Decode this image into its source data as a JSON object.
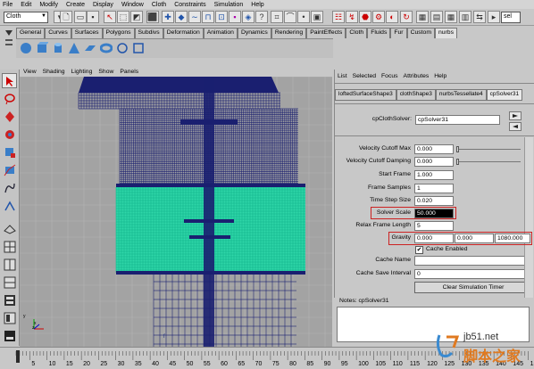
{
  "menubar": [
    "File",
    "Edit",
    "Modify",
    "Create",
    "Display",
    "Window",
    "Cloth",
    "Constraints",
    "Simulation",
    "Help"
  ],
  "status": {
    "mode": "Cloth",
    "field_right": "sel"
  },
  "shelf_tabs": [
    "General",
    "Curves",
    "Surfaces",
    "Polygons",
    "Subdivs",
    "Deformation",
    "Animation",
    "Dynamics",
    "Rendering",
    "PaintEffects",
    "Cloth",
    "Fluids",
    "Fur",
    "Custom",
    "nurbs"
  ],
  "shelf_selected": "nurbs",
  "viewport": {
    "menu": [
      "View",
      "Shading",
      "Lighting",
      "Show",
      "Panels"
    ],
    "frame_label": "f",
    "axis": {
      "x": "x",
      "y": "y",
      "z": "z"
    }
  },
  "attribute_editor": {
    "menu": [
      "List",
      "Selected",
      "Focus",
      "Attributes",
      "Help"
    ],
    "tabs": [
      "loftedSurfaceShape3",
      "clothShape3",
      "nurbsTessellate4",
      "cpSolver31"
    ],
    "selected_tab": "cpSolver31",
    "node_label": "cpClothSolver:",
    "node_name": "cpSolver31",
    "attributes": [
      {
        "label": "Velocity Cutoff Max",
        "value": "0.000"
      },
      {
        "label": "Velocity Cutoff Damping",
        "value": "0.000"
      },
      {
        "label": "Start Frame",
        "value": "1.000"
      },
      {
        "label": "Frame Samples",
        "value": "1"
      },
      {
        "label": "Time Step Size",
        "value": "0.020"
      },
      {
        "label": "Solver Scale",
        "value": "50.000"
      },
      {
        "label": "Relax Frame Length",
        "value": "5"
      }
    ],
    "gravity": {
      "label": "Gravity",
      "x": "0.000",
      "y": "0.000",
      "z": "1080.000"
    },
    "cache_enabled_label": "Cache Enabled",
    "cache_name_label": "Cache Name",
    "cache_name": "",
    "cache_save_interval_label": "Cache Save Interval",
    "cache_save_interval": "0",
    "clear_button": "Clear Simulation Timer",
    "notes_label": "Notes: cpSolver31"
  },
  "timeline": {
    "ticks": [
      "5",
      "10",
      "15",
      "20",
      "25",
      "30",
      "35",
      "40",
      "45",
      "50",
      "55",
      "60",
      "65",
      "70",
      "75",
      "80",
      "85",
      "90",
      "95",
      "100",
      "105",
      "110",
      "115",
      "120",
      "125",
      "130",
      "135",
      "140",
      "145",
      "150"
    ]
  },
  "watermark": {
    "line1": "jb51.net",
    "line2": "脚本之家"
  }
}
